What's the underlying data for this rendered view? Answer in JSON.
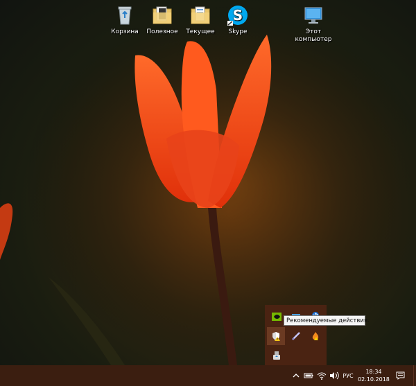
{
  "desktop": {
    "icons": [
      {
        "label": "Корзина",
        "icon": "recycle-bin-icon"
      },
      {
        "label": "Полезное",
        "icon": "folder-icon"
      },
      {
        "label": "Текущее",
        "icon": "folder-icon"
      },
      {
        "label": "Skype",
        "icon": "skype-icon"
      },
      {
        "label": "Этот компьютер",
        "icon": "computer-icon"
      }
    ]
  },
  "tray_overflow": {
    "tooltip": "Рекомендуемые действия.",
    "icons": [
      "nvidia-icon",
      "network-adapter-icon",
      "bluetooth-icon",
      "security-warning-icon",
      "pen-icon",
      "warning-fire-icon",
      "usb-eject-icon"
    ]
  },
  "taskbar": {
    "language": "РУС",
    "time": "18:34",
    "date": "02.10.2018",
    "colors": {
      "background": "#3b1e10",
      "panel": "#4a2312"
    }
  }
}
